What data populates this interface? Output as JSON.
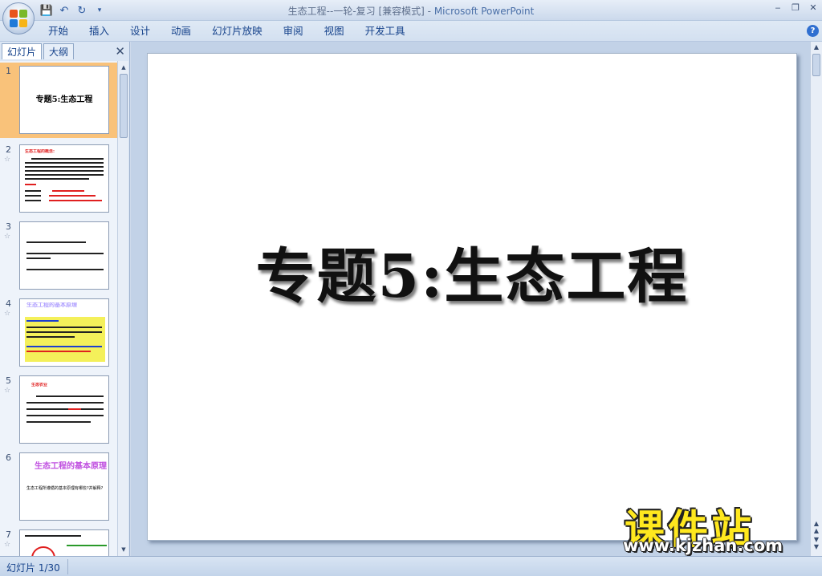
{
  "window": {
    "title_doc": "生态工程--一轮-复习 [兼容模式]",
    "title_sep": " - ",
    "title_app": "Microsoft PowerPoint"
  },
  "quick_access": {
    "save_icon": "💾",
    "undo_icon": "↶",
    "redo_icon": "↻",
    "customize_icon": "▾"
  },
  "menu": {
    "tabs": [
      "开始",
      "插入",
      "设计",
      "动画",
      "幻灯片放映",
      "审阅",
      "视图",
      "开发工具"
    ]
  },
  "panel": {
    "tab_slides": "幻灯片",
    "tab_outline": "大纲",
    "close": "✕"
  },
  "thumbnails": [
    {
      "num": "1",
      "title": "专题5:生态工程"
    },
    {
      "num": "2",
      "star": "☆",
      "heading": "生态工程的概念:"
    },
    {
      "num": "3",
      "star": "☆"
    },
    {
      "num": "4",
      "star": "☆",
      "heading": "生态工程的基本原理"
    },
    {
      "num": "5",
      "star": "☆",
      "heading": "生态农业"
    },
    {
      "num": "6",
      "star": "☆",
      "heading": "生态工程的基本原理",
      "body": "生态工程所遵循的基本原理有哪些?并解释?"
    },
    {
      "num": "7",
      "star": "☆"
    }
  ],
  "slide": {
    "title": "专题5:生态工程"
  },
  "watermark": {
    "cn": "课件站",
    "url": "www.kjzhan.com"
  },
  "status": {
    "slide_info": "幻灯片 1/30"
  },
  "colors": {
    "accent": "#15428b",
    "selected_thumb": "#f9c27a",
    "watermark_yellow": "#ffe81e"
  }
}
